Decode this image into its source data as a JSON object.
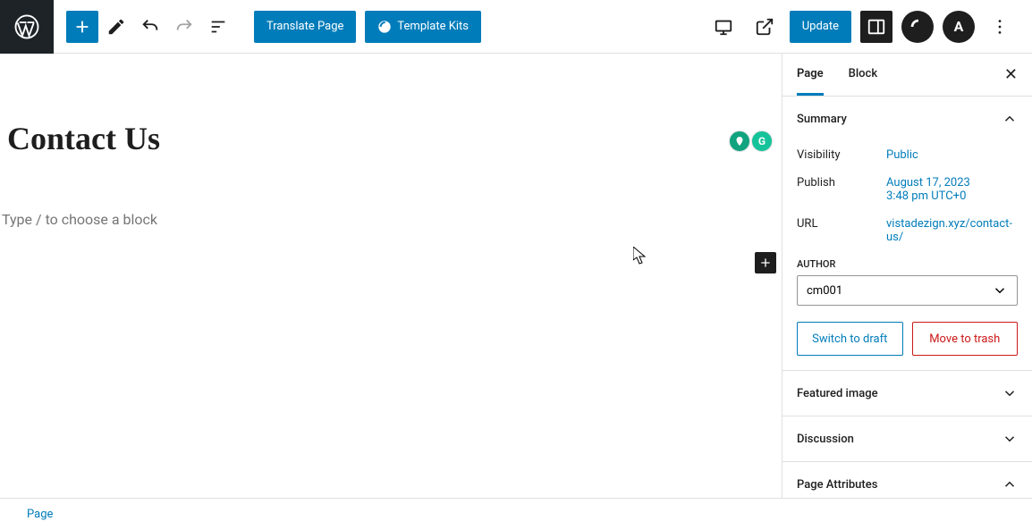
{
  "toolbar": {
    "translate_label": "Translate Page",
    "template_kits_label": "Template Kits",
    "update_label": "Update"
  },
  "editor": {
    "title": "Contact Us",
    "block_placeholder": "Type / to choose a block"
  },
  "sidebar": {
    "tabs": {
      "page": "Page",
      "block": "Block"
    },
    "summary": {
      "title": "Summary",
      "visibility_label": "Visibility",
      "visibility_value": "Public",
      "publish_label": "Publish",
      "publish_value_line1": "August 17, 2023",
      "publish_value_line2": "3:48 pm UTC+0",
      "url_label": "URL",
      "url_value": "vistadezign.xyz/contact-us/",
      "author_label": "AUTHOR",
      "author_value": "cm001",
      "switch_draft": "Switch to draft",
      "move_trash": "Move to trash"
    },
    "panels": {
      "featured_image": "Featured image",
      "discussion": "Discussion",
      "page_attributes": "Page Attributes"
    }
  },
  "footer": {
    "breadcrumb": "Page"
  }
}
